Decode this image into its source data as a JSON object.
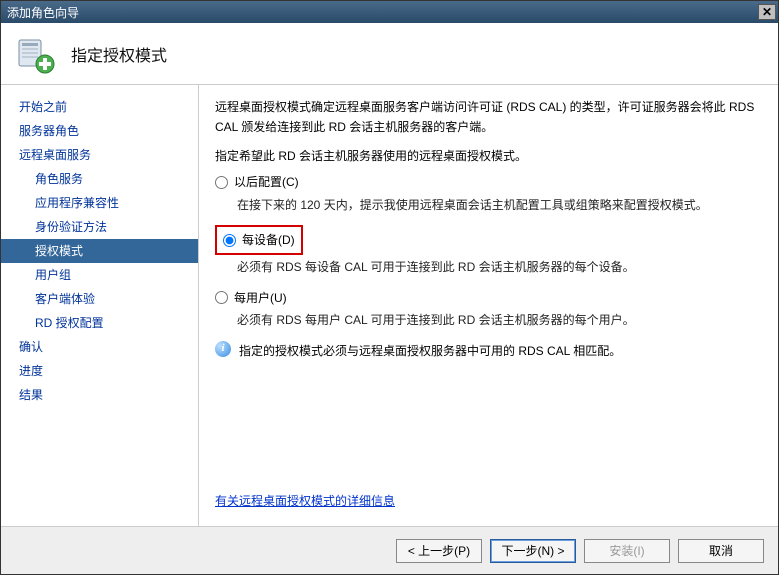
{
  "window": {
    "title": "添加角色向导"
  },
  "header": {
    "title": "指定授权模式"
  },
  "sidebar": {
    "items": [
      {
        "label": "开始之前",
        "sub": false
      },
      {
        "label": "服务器角色",
        "sub": false
      },
      {
        "label": "远程桌面服务",
        "sub": false
      },
      {
        "label": "角色服务",
        "sub": true
      },
      {
        "label": "应用程序兼容性",
        "sub": true
      },
      {
        "label": "身份验证方法",
        "sub": true
      },
      {
        "label": "授权模式",
        "sub": true,
        "selected": true
      },
      {
        "label": "用户组",
        "sub": true
      },
      {
        "label": "客户端体验",
        "sub": true
      },
      {
        "label": "RD 授权配置",
        "sub": true
      },
      {
        "label": "确认",
        "sub": false
      },
      {
        "label": "进度",
        "sub": false
      },
      {
        "label": "结果",
        "sub": false
      }
    ]
  },
  "content": {
    "intro1": "远程桌面授权模式确定远程桌面服务客户端访问许可证 (RDS CAL) 的类型，许可证服务器会将此 RDS CAL 颁发给连接到此 RD 会话主机服务器的客户端。",
    "intro2": "指定希望此 RD 会话主机服务器使用的远程桌面授权模式。",
    "options": [
      {
        "key": "later",
        "label": "以后配置(C)",
        "desc": "在接下来的 120 天内，提示我使用远程桌面会话主机配置工具或组策略来配置授权模式。",
        "checked": false
      },
      {
        "key": "device",
        "label": "每设备(D)",
        "desc": "必须有 RDS 每设备 CAL 可用于连接到此 RD 会话主机服务器的每个设备。",
        "checked": true,
        "highlight": true
      },
      {
        "key": "user",
        "label": "每用户(U)",
        "desc": "必须有 RDS 每用户 CAL 可用于连接到此 RD 会话主机服务器的每个用户。",
        "checked": false
      }
    ],
    "info": "指定的授权模式必须与远程桌面授权服务器中可用的 RDS CAL 相匹配。",
    "link": "有关远程桌面授权模式的详细信息"
  },
  "footer": {
    "prev": "< 上一步(P)",
    "next": "下一步(N) >",
    "install": "安装(I)",
    "cancel": "取消"
  }
}
